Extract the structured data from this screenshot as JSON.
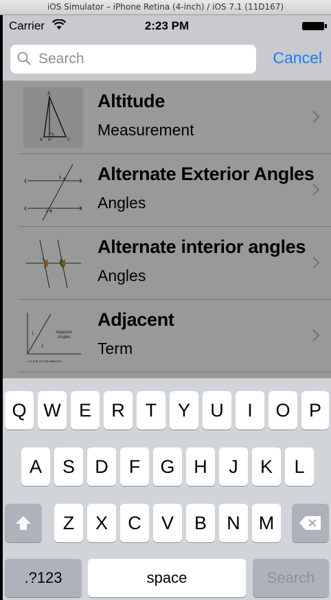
{
  "simulator": {
    "title": "iOS Simulator – iPhone Retina (4-inch) / iOS 7.1 (11D167)"
  },
  "status_bar": {
    "carrier": "Carrier",
    "time": "2:23 PM"
  },
  "search": {
    "placeholder": "Search",
    "value": "",
    "cancel_label": "Cancel"
  },
  "results": [
    {
      "title": "Altitude",
      "subtitle": "Measurement",
      "thumbnail": "altitude-triangle"
    },
    {
      "title": "Alternate Exterior Angles",
      "subtitle": "Angles",
      "thumbnail": "parallel-lines-transversal"
    },
    {
      "title": "Alternate interior angles",
      "subtitle": "Angles",
      "thumbnail": "alternate-interior-angles-diagram"
    },
    {
      "title": "Adjacent",
      "subtitle": "Term",
      "thumbnail": "adjacent-angles-diagram"
    }
  ],
  "thumbnail_text": {
    "altitude": [
      "A",
      "B",
      "H",
      "C"
    ],
    "exterior": [
      "8",
      "2"
    ],
    "adjacent": [
      "1",
      "2",
      "Adjacent",
      "Angles",
      "∠1 and ∠2 are adjacent."
    ]
  },
  "keyboard": {
    "row1": [
      "Q",
      "W",
      "E",
      "R",
      "T",
      "Y",
      "U",
      "I",
      "O",
      "P"
    ],
    "row2": [
      "A",
      "S",
      "D",
      "F",
      "G",
      "H",
      "J",
      "K",
      "L"
    ],
    "row3": [
      "Z",
      "X",
      "C",
      "V",
      "B",
      "N",
      "M"
    ],
    "numbers_label": ".?123",
    "space_label": "space",
    "search_label": "Search"
  },
  "colors": {
    "accent": "#1a7df5",
    "bar": "#c9c9ce",
    "keyboard": "#d1d4d9",
    "dark_key": "#adb2bb"
  }
}
